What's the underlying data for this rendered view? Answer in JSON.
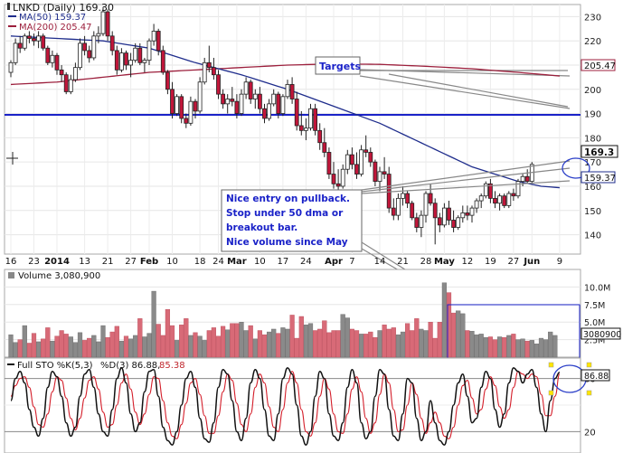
{
  "chart_data": [
    {
      "type": "candlestick",
      "title": "LNKD (Daily) 169.30",
      "symbol": "LNKD",
      "legend": [
        {
          "name": "MA(50) 159.37",
          "color": "#1f2d8c"
        },
        {
          "name": "MA(200) 205.47",
          "color": "#9c1f3c"
        }
      ],
      "ylim": [
        132,
        235
      ],
      "yticks": [
        140,
        150,
        160,
        170,
        180,
        190,
        200,
        210,
        220,
        230
      ],
      "x_ticks": [
        {
          "i": 0,
          "label": "16"
        },
        {
          "i": 5,
          "label": "23"
        },
        {
          "i": 10,
          "label": "2014"
        },
        {
          "i": 16,
          "label": "13"
        },
        {
          "i": 21,
          "label": "21"
        },
        {
          "i": 26,
          "label": "27"
        },
        {
          "i": 30,
          "label": "Feb"
        },
        {
          "i": 35,
          "label": "10"
        },
        {
          "i": 41,
          "label": "18"
        },
        {
          "i": 45,
          "label": "24"
        },
        {
          "i": 49,
          "label": "Mar"
        },
        {
          "i": 54,
          "label": "10"
        },
        {
          "i": 59,
          "label": "17"
        },
        {
          "i": 64,
          "label": "24"
        },
        {
          "i": 70,
          "label": "Apr"
        },
        {
          "i": 74,
          "label": "7"
        },
        {
          "i": 80,
          "label": "14"
        },
        {
          "i": 85,
          "label": "21"
        },
        {
          "i": 90,
          "label": "28"
        },
        {
          "i": 94,
          "label": "May"
        },
        {
          "i": 99,
          "label": "12"
        },
        {
          "i": 104,
          "label": "19"
        },
        {
          "i": 109,
          "label": "27"
        },
        {
          "i": 113,
          "label": "Jun"
        },
        {
          "i": 119,
          "label": "9"
        }
      ],
      "last_price": 169.3,
      "ma50_last": 159.37,
      "ma200_last": 205.47,
      "horizontal_line": {
        "value": 184,
        "color": "#1a22c8"
      },
      "annotations": [
        {
          "text": "Targets"
        },
        {
          "text": "Nice entry on pullback. Stop under 50 dma or breakout bar.  Nice volume since May"
        }
      ],
      "candles": [
        [
          207,
          212,
          205,
          211
        ],
        [
          211,
          221,
          210,
          219
        ],
        [
          219,
          222,
          215,
          217
        ],
        [
          217,
          223,
          216,
          222
        ],
        [
          222,
          224,
          219,
          221
        ],
        [
          221,
          223,
          218,
          220
        ],
        [
          220,
          224,
          217,
          222
        ],
        [
          222,
          223,
          216,
          217
        ],
        [
          217,
          218,
          210,
          211
        ],
        [
          211,
          216,
          209,
          214
        ],
        [
          214,
          215,
          206,
          208
        ],
        [
          208,
          210,
          203,
          206
        ],
        [
          206,
          207,
          198,
          199
        ],
        [
          199,
          206,
          198,
          204
        ],
        [
          204,
          211,
          203,
          209
        ],
        [
          209,
          221,
          208,
          219
        ],
        [
          219,
          222,
          214,
          216
        ],
        [
          216,
          218,
          211,
          213
        ],
        [
          213,
          224,
          212,
          222
        ],
        [
          222,
          226,
          219,
          223
        ],
        [
          223,
          234,
          222,
          232
        ],
        [
          232,
          233,
          220,
          222
        ],
        [
          222,
          224,
          214,
          216
        ],
        [
          216,
          218,
          206,
          208
        ],
        [
          208,
          217,
          207,
          215
        ],
        [
          215,
          216,
          208,
          210
        ],
        [
          210,
          215,
          205,
          212
        ],
        [
          212,
          219,
          211,
          217
        ],
        [
          217,
          219,
          210,
          211
        ],
        [
          211,
          213,
          207,
          212
        ],
        [
          212,
          221,
          210,
          220
        ],
        [
          220,
          227,
          218,
          224
        ],
        [
          224,
          225,
          214,
          216
        ],
        [
          216,
          218,
          206,
          207
        ],
        [
          207,
          208,
          198,
          200
        ],
        [
          200,
          203,
          188,
          190
        ],
        [
          190,
          198,
          189,
          197
        ],
        [
          197,
          198,
          186,
          188
        ],
        [
          188,
          190,
          184,
          186
        ],
        [
          186,
          197,
          185,
          195
        ],
        [
          195,
          196,
          188,
          191
        ],
        [
          191,
          205,
          190,
          203
        ],
        [
          203,
          213,
          202,
          211
        ],
        [
          211,
          218,
          207,
          209
        ],
        [
          209,
          213,
          204,
          206
        ],
        [
          206,
          208,
          196,
          198
        ],
        [
          198,
          200,
          192,
          194
        ],
        [
          194,
          198,
          190,
          196
        ],
        [
          196,
          201,
          193,
          195
        ],
        [
          195,
          198,
          188,
          190
        ],
        [
          190,
          200,
          189,
          198
        ],
        [
          198,
          205,
          196,
          203
        ],
        [
          203,
          204,
          194,
          196
        ],
        [
          196,
          200,
          192,
          198
        ],
        [
          198,
          201,
          190,
          192
        ],
        [
          192,
          194,
          186,
          188
        ],
        [
          188,
          196,
          187,
          194
        ],
        [
          194,
          200,
          193,
          198
        ],
        [
          198,
          199,
          188,
          190
        ],
        [
          190,
          198,
          189,
          197
        ],
        [
          197,
          204,
          196,
          202
        ],
        [
          202,
          205,
          194,
          196
        ],
        [
          196,
          199,
          183,
          185
        ],
        [
          185,
          191,
          181,
          183
        ],
        [
          183,
          188,
          179,
          184
        ],
        [
          184,
          194,
          183,
          192
        ],
        [
          192,
          194,
          181,
          183
        ],
        [
          183,
          186,
          175,
          178
        ],
        [
          178,
          184,
          172,
          174
        ],
        [
          174,
          176,
          163,
          165
        ],
        [
          165,
          170,
          159,
          161
        ],
        [
          161,
          167,
          158,
          160
        ],
        [
          160,
          169,
          159,
          167
        ],
        [
          167,
          175,
          165,
          173
        ],
        [
          173,
          176,
          167,
          169
        ],
        [
          169,
          174,
          163,
          165
        ],
        [
          165,
          177,
          164,
          175
        ],
        [
          175,
          181,
          172,
          174
        ],
        [
          174,
          176,
          168,
          170
        ],
        [
          170,
          171,
          160,
          162
        ],
        [
          162,
          168,
          158,
          166
        ],
        [
          166,
          172,
          163,
          165
        ],
        [
          165,
          168,
          149,
          151
        ],
        [
          151,
          155,
          146,
          148
        ],
        [
          148,
          157,
          146,
          155
        ],
        [
          155,
          160,
          152,
          157
        ],
        [
          157,
          158,
          151,
          153
        ],
        [
          153,
          154,
          146,
          147
        ],
        [
          147,
          149,
          141,
          143
        ],
        [
          143,
          150,
          139,
          148
        ],
        [
          148,
          158,
          145,
          157
        ],
        [
          157,
          161,
          152,
          153
        ],
        [
          153,
          155,
          136,
          147
        ],
        [
          147,
          149,
          141,
          144
        ],
        [
          144,
          153,
          143,
          151
        ],
        [
          151,
          154,
          144,
          146
        ],
        [
          146,
          150,
          141,
          143
        ],
        [
          143,
          148,
          142,
          147
        ],
        [
          147,
          152,
          145,
          149
        ],
        [
          149,
          152,
          146,
          148
        ],
        [
          148,
          152,
          145,
          151
        ],
        [
          151,
          155,
          149,
          154
        ],
        [
          154,
          157,
          151,
          156
        ],
        [
          156,
          162,
          155,
          161
        ],
        [
          161,
          163,
          153,
          155
        ],
        [
          155,
          158,
          151,
          153
        ],
        [
          153,
          157,
          150,
          156
        ],
        [
          156,
          157,
          151,
          152
        ],
        [
          152,
          158,
          151,
          157
        ],
        [
          157,
          159,
          154,
          156
        ],
        [
          156,
          163,
          155,
          162
        ],
        [
          162,
          165,
          160,
          164
        ],
        [
          164,
          167,
          161,
          162
        ],
        [
          162,
          170,
          161,
          169
        ]
      ],
      "ma50": [
        {
          "i": 0,
          "v": 222
        },
        {
          "i": 10,
          "v": 221
        },
        {
          "i": 20,
          "v": 220
        },
        {
          "i": 30,
          "v": 217
        },
        {
          "i": 40,
          "v": 211
        },
        {
          "i": 50,
          "v": 206
        },
        {
          "i": 60,
          "v": 200
        },
        {
          "i": 70,
          "v": 193
        },
        {
          "i": 80,
          "v": 186
        },
        {
          "i": 90,
          "v": 177
        },
        {
          "i": 100,
          "v": 168
        },
        {
          "i": 110,
          "v": 162
        },
        {
          "i": 115,
          "v": 160
        },
        {
          "i": 119,
          "v": 159.4
        }
      ],
      "ma200": [
        {
          "i": 0,
          "v": 202
        },
        {
          "i": 10,
          "v": 203
        },
        {
          "i": 20,
          "v": 205
        },
        {
          "i": 30,
          "v": 207
        },
        {
          "i": 40,
          "v": 208
        },
        {
          "i": 50,
          "v": 209
        },
        {
          "i": 60,
          "v": 210
        },
        {
          "i": 70,
          "v": 210.5
        },
        {
          "i": 80,
          "v": 210.3
        },
        {
          "i": 90,
          "v": 209.5
        },
        {
          "i": 100,
          "v": 208.5
        },
        {
          "i": 110,
          "v": 207
        },
        {
          "i": 119,
          "v": 205.5
        }
      ]
    },
    {
      "type": "bar",
      "title": "Volume 3,080,900",
      "last_value": 3080900,
      "last_value_label": "3080900",
      "ylim": [
        0,
        12.5
      ],
      "yticks": [
        {
          "v": 2.5,
          "label": "2.5M"
        },
        {
          "v": 5.0,
          "label": "5.0M"
        },
        {
          "v": 7.5,
          "label": "7.5M"
        },
        {
          "v": 10.0,
          "label": "10.0M"
        }
      ],
      "values": [
        3.2,
        2.1,
        2.5,
        4.5,
        2.0,
        3.4,
        2.2,
        2.6,
        4.2,
        2.3,
        3.0,
        3.8,
        3.3,
        2.9,
        2.1,
        3.5,
        2.4,
        2.7,
        3.1,
        2.2,
        4.5,
        2.8,
        3.6,
        4.4,
        2.3,
        3.0,
        2.6,
        3.1,
        5.5,
        2.9,
        3.4,
        9.4,
        4.7,
        3.1,
        6.8,
        4.5,
        2.4,
        4.6,
        5.5,
        3.1,
        3.5,
        3.0,
        2.4,
        3.8,
        4.2,
        3.0,
        4.4,
        3.9,
        4.8,
        4.8,
        5.0,
        3.8,
        4.5,
        2.6,
        3.8,
        3.2,
        3.6,
        4.0,
        3.4,
        4.2,
        4.0,
        6.0,
        2.7,
        5.8,
        4.6,
        4.8,
        3.8,
        4.0,
        5.2,
        3.5,
        3.8,
        3.8,
        6.1,
        5.6,
        4.0,
        3.8,
        3.3,
        3.3,
        3.6,
        2.8,
        3.8,
        4.6,
        4.0,
        4.2,
        3.2,
        3.6,
        4.8,
        3.8,
        5.5,
        4.0,
        3.8,
        5.0,
        2.7,
        5.0,
        10.6,
        9.2,
        6.3,
        6.6,
        6.2,
        3.8,
        3.7,
        3.2,
        3.3,
        2.8,
        2.9,
        2.5,
        2.9,
        2.8,
        3.1,
        3.3,
        2.5,
        2.6,
        2.3,
        2.4,
        1.9,
        2.7,
        2.5,
        3.6,
        3.1
      ]
    },
    {
      "type": "line",
      "title": "Full STO %K(5,3) %D(3) 86.88, 85.38",
      "k_label": "Full STO %K(5,3)",
      "d_label": "%D(3) 86.88,",
      "d_last_label": "85.38",
      "k_last": 86.88,
      "d_last": 85.38,
      "ylim": [
        0,
        100
      ],
      "yticks": [
        20,
        80
      ],
      "last_label": "86.88",
      "k": [
        55,
        80,
        88,
        75,
        45,
        25,
        15,
        35,
        70,
        88,
        82,
        60,
        30,
        15,
        25,
        60,
        85,
        90,
        70,
        40,
        20,
        15,
        45,
        80,
        92,
        75,
        40,
        20,
        30,
        65,
        88,
        90,
        60,
        25,
        10,
        5,
        20,
        50,
        80,
        88,
        70,
        35,
        12,
        8,
        30,
        70,
        90,
        85,
        55,
        20,
        10,
        35,
        75,
        90,
        80,
        45,
        15,
        10,
        40,
        80,
        92,
        85,
        50,
        15,
        5,
        20,
        60,
        88,
        80,
        40,
        15,
        10,
        30,
        70,
        90,
        75,
        30,
        12,
        20,
        60,
        90,
        85,
        45,
        15,
        10,
        40,
        80,
        75,
        35,
        10,
        20,
        55,
        30,
        10,
        5,
        20,
        50,
        75,
        85,
        60,
        30,
        35,
        70,
        88,
        80,
        45,
        25,
        40,
        75,
        92,
        88,
        75,
        85,
        90,
        70,
        40,
        20,
        55,
        80,
        87
      ],
      "d": [
        60,
        72,
        80,
        82,
        70,
        48,
        28,
        25,
        40,
        65,
        82,
        78,
        58,
        35,
        22,
        35,
        58,
        78,
        82,
        68,
        42,
        25,
        28,
        50,
        75,
        85,
        68,
        42,
        28,
        40,
        62,
        82,
        80,
        55,
        30,
        15,
        12,
        28,
        52,
        75,
        80,
        62,
        38,
        18,
        18,
        38,
        65,
        85,
        78,
        52,
        28,
        20,
        40,
        70,
        85,
        75,
        48,
        25,
        20,
        45,
        75,
        88,
        75,
        45,
        20,
        15,
        30,
        60,
        80,
        68,
        40,
        20,
        18,
        40,
        68,
        82,
        65,
        35,
        18,
        30,
        62,
        85,
        75,
        45,
        20,
        22,
        50,
        75,
        62,
        35,
        18,
        30,
        42,
        30,
        15,
        12,
        25,
        50,
        72,
        78,
        58,
        40,
        45,
        68,
        82,
        72,
        48,
        35,
        45,
        70,
        88,
        85,
        80,
        85,
        82,
        62,
        38,
        38,
        60,
        85
      ]
    }
  ]
}
